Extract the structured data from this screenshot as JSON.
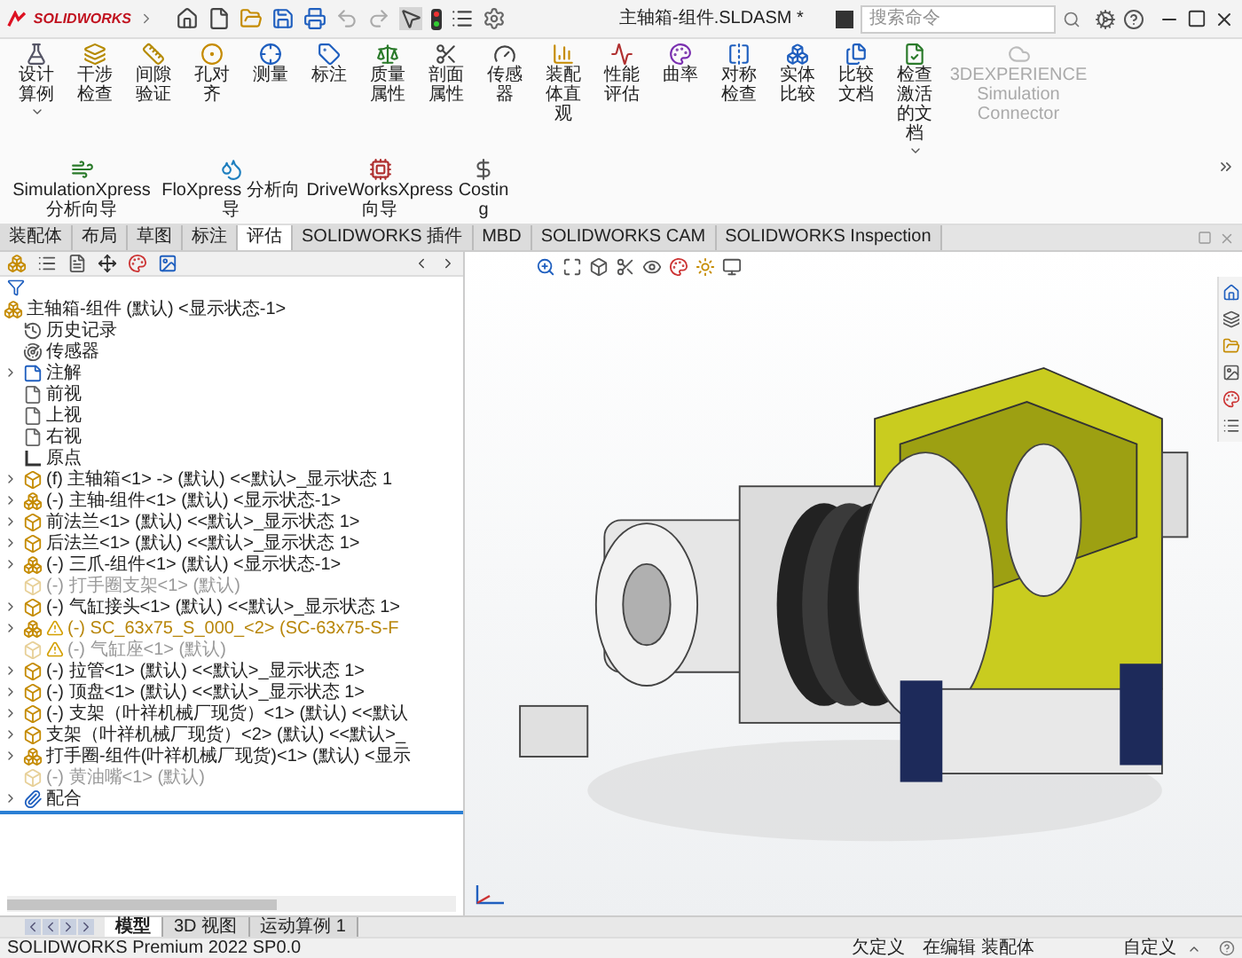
{
  "app": {
    "logo": "SOLIDWORKS",
    "title": "主轴箱-组件.SLDASM *",
    "search": {
      "placeholder": "搜索命令"
    }
  },
  "ribbon": [
    {
      "label": "设计算例",
      "disabled": false,
      "caret": true
    },
    {
      "label": "干涉检查",
      "disabled": false,
      "caret": false
    },
    {
      "label": "间隙验证",
      "disabled": false,
      "caret": false
    },
    {
      "label": "孔对齐",
      "disabled": false,
      "caret": false
    },
    {
      "label": "测量",
      "disabled": false,
      "caret": false
    },
    {
      "label": "标注",
      "disabled": false,
      "caret": false
    },
    {
      "label": "质量属性",
      "disabled": false,
      "caret": false
    },
    {
      "label": "剖面属性",
      "disabled": false,
      "caret": false
    },
    {
      "label": "传感器",
      "disabled": false,
      "caret": false
    },
    {
      "label": "装配体直观",
      "disabled": false,
      "caret": false
    },
    {
      "label": "性能评估",
      "disabled": false,
      "caret": false
    },
    {
      "label": "曲率",
      "disabled": false,
      "caret": false
    },
    {
      "label": "对称检查",
      "disabled": false,
      "caret": false
    },
    {
      "label": "实体比较",
      "disabled": false,
      "caret": false
    },
    {
      "label": "比较文档",
      "disabled": false,
      "caret": false
    },
    {
      "label": "检查激活的文档",
      "disabled": false,
      "caret": true
    },
    {
      "label": "3DEXPERIENCE Simulation Connector",
      "disabled": true,
      "caret": false
    },
    {
      "label": "SimulationXpress 分析向导",
      "disabled": false,
      "caret": false
    },
    {
      "label": "FloXpress 分析向导",
      "disabled": false,
      "caret": false
    },
    {
      "label": "DriveWorksXpress 向导",
      "disabled": false,
      "caret": false
    },
    {
      "label": "Costing",
      "disabled": false,
      "caret": false
    }
  ],
  "tabs": [
    {
      "label": "装配体",
      "selected": false
    },
    {
      "label": "布局",
      "selected": false
    },
    {
      "label": "草图",
      "selected": false
    },
    {
      "label": "标注",
      "selected": false
    },
    {
      "label": "评估",
      "selected": true
    },
    {
      "label": "SOLIDWORKS 插件",
      "selected": false
    },
    {
      "label": "MBD",
      "selected": false
    },
    {
      "label": "SOLIDWORKS CAM",
      "selected": false
    },
    {
      "label": "SOLIDWORKS Inspection",
      "selected": false
    }
  ],
  "tree": {
    "root": {
      "text": "主轴箱-组件 (默认) <显示状态-1>",
      "kind": "assembly"
    },
    "items": [
      {
        "text": "历史记录",
        "kind": "history",
        "suppressed": false,
        "warning": false
      },
      {
        "text": "传感器",
        "kind": "sensor",
        "suppressed": false,
        "warning": false
      },
      {
        "text": "注解",
        "kind": "annotation",
        "expanded": false,
        "suppressed": false,
        "warning": false
      },
      {
        "text": "前视",
        "kind": "plane",
        "suppressed": false,
        "warning": false
      },
      {
        "text": "上视",
        "kind": "plane",
        "suppressed": false,
        "warning": false
      },
      {
        "text": "右视",
        "kind": "plane",
        "suppressed": false,
        "warning": false
      },
      {
        "text": "原点",
        "kind": "origin",
        "suppressed": false,
        "warning": false
      },
      {
        "text": "(f) 主轴箱<1> -> (默认) <<默认>_显示状态 1",
        "kind": "part",
        "expanded": false,
        "suppressed": false,
        "warning": false
      },
      {
        "text": "(-) 主轴-组件<1> (默认) <显示状态-1>",
        "kind": "assembly",
        "expanded": false,
        "suppressed": false,
        "warning": false
      },
      {
        "text": "前法兰<1> (默认) <<默认>_显示状态 1>",
        "kind": "part",
        "expanded": false,
        "suppressed": false,
        "warning": false
      },
      {
        "text": "后法兰<1> (默认) <<默认>_显示状态 1>",
        "kind": "part",
        "expanded": false,
        "suppressed": false,
        "warning": false
      },
      {
        "text": "(-) 三爪-组件<1> (默认) <显示状态-1>",
        "kind": "assembly",
        "expanded": false,
        "suppressed": false,
        "warning": false
      },
      {
        "text": "(-) 打手圈支架<1> (默认)",
        "kind": "part",
        "suppressed": true,
        "warning": false
      },
      {
        "text": "(-) 气缸接头<1> (默认) <<默认>_显示状态 1>",
        "kind": "part",
        "expanded": false,
        "suppressed": false,
        "warning": false
      },
      {
        "text": "(-) SC_63x75_S_000_<2> (SC-63x75-S-F",
        "kind": "assembly",
        "expanded": false,
        "suppressed": false,
        "warning": true
      },
      {
        "text": "(-) 气缸座<1> (默认)",
        "kind": "part",
        "suppressed": true,
        "warning": true
      },
      {
        "text": "(-) 拉管<1> (默认) <<默认>_显示状态 1>",
        "kind": "part",
        "expanded": false,
        "suppressed": false,
        "warning": false
      },
      {
        "text": "(-) 顶盘<1> (默认) <<默认>_显示状态 1>",
        "kind": "part",
        "expanded": false,
        "suppressed": false,
        "warning": false
      },
      {
        "text": "(-) 支架（叶祥机械厂现货）<1> (默认) <<默认",
        "kind": "part",
        "expanded": false,
        "suppressed": false,
        "warning": false
      },
      {
        "text": "支架（叶祥机械厂现货）<2> (默认) <<默认>_",
        "kind": "part",
        "expanded": false,
        "suppressed": false,
        "warning": false
      },
      {
        "text": "打手圈-组件(叶祥机械厂现货)<1> (默认) <显示",
        "kind": "assembly",
        "expanded": false,
        "suppressed": false,
        "warning": false
      },
      {
        "text": "(-) 黄油嘴<1> (默认)",
        "kind": "part",
        "suppressed": true,
        "warning": false
      },
      {
        "text": "配合",
        "kind": "mates",
        "expanded": false,
        "suppressed": false,
        "warning": false
      }
    ]
  },
  "bottom_tabs": [
    {
      "label": "模型",
      "selected": true
    },
    {
      "label": "3D 视图",
      "selected": false
    },
    {
      "label": "运动算例 1",
      "selected": false
    }
  ],
  "status_bar": {
    "product": "SOLIDWORKS Premium 2022 SP0.0",
    "definition": "欠定义",
    "mode": "在编辑 装配体",
    "units": "自定义"
  }
}
